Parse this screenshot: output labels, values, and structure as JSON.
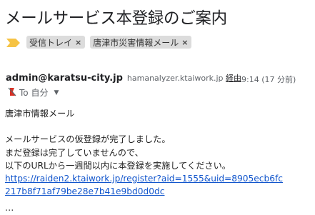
{
  "subject": "メールサービス本登録のご案内",
  "labels": [
    {
      "name": "受信トレイ",
      "remove": "×"
    },
    {
      "name": "唐津市災害情報メール",
      "remove": "×"
    }
  ],
  "sender": {
    "email": "admin@karatsu-city.jp",
    "via_domain": "hamanalyzer.ktaiwork.jp",
    "via_label": "経由",
    "time": "9:14 (17 分前)"
  },
  "recipient": {
    "text": "To 自分"
  },
  "body": {
    "line1": "唐津市情報メール",
    "line2": "メールサービスの仮登録が完了しました。",
    "line3": "まだ登録は完了していませんので、",
    "line4": "以下のURLから一週間以内に本登録を実施してください。",
    "link_line1": "https://raiden2.ktaiwork.jp/register?aid=1555&uid=8905ecb6fc",
    "link_line2": "217b8f71af79be28e7b41e9bd0d0dc"
  },
  "ellipsis": "...",
  "colors": {
    "link": "#1155cc",
    "importance": "#f6c344",
    "chip_bg": "#dcdcdc"
  }
}
